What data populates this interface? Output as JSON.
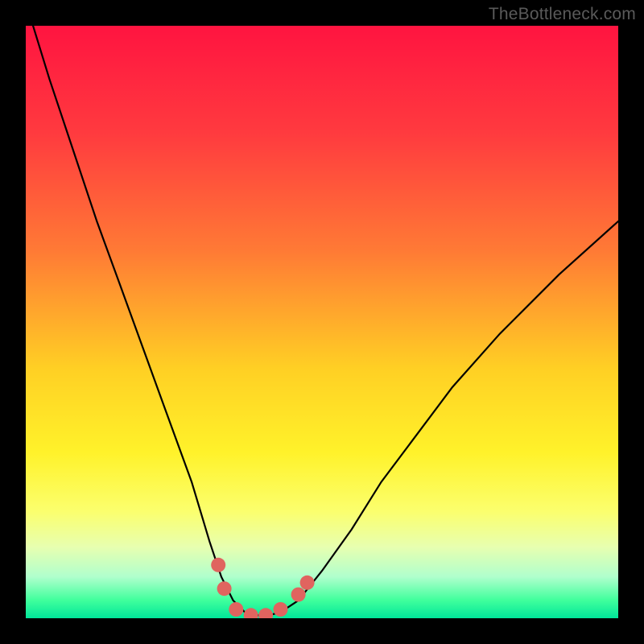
{
  "watermark": "TheBottleneck.com",
  "colors": {
    "frame": "#000000",
    "gradient_stops": [
      {
        "pct": 0,
        "color": "#ff1440"
      },
      {
        "pct": 18,
        "color": "#ff3a3f"
      },
      {
        "pct": 38,
        "color": "#ff7a35"
      },
      {
        "pct": 58,
        "color": "#ffd024"
      },
      {
        "pct": 72,
        "color": "#fff22a"
      },
      {
        "pct": 82,
        "color": "#fbff6e"
      },
      {
        "pct": 88,
        "color": "#e7ffb0"
      },
      {
        "pct": 93,
        "color": "#b0ffcd"
      },
      {
        "pct": 97,
        "color": "#3fff9c"
      },
      {
        "pct": 100,
        "color": "#00e69a"
      }
    ],
    "curve": "#000000",
    "markers": "#e0645f"
  },
  "chart_data": {
    "type": "line",
    "title": "",
    "xlabel": "",
    "ylabel": "",
    "xlim": [
      0,
      100
    ],
    "ylim": [
      0,
      100
    ],
    "series": [
      {
        "name": "bottleneck-curve",
        "x": [
          0,
          4,
          8,
          12,
          16,
          20,
          24,
          28,
          31,
          33,
          35,
          37,
          39,
          41,
          43,
          46,
          50,
          55,
          60,
          66,
          72,
          80,
          90,
          100
        ],
        "y": [
          104,
          91,
          79,
          67,
          56,
          45,
          34,
          23,
          13,
          7,
          3,
          1,
          0.5,
          0.5,
          1,
          3,
          8,
          15,
          23,
          31,
          39,
          48,
          58,
          67
        ]
      }
    ],
    "markers": {
      "name": "minimum-region",
      "points": [
        {
          "x": 32.5,
          "y": 9,
          "r": 9
        },
        {
          "x": 33.5,
          "y": 5,
          "r": 9
        },
        {
          "x": 35.5,
          "y": 1.5,
          "r": 9
        },
        {
          "x": 38,
          "y": 0.5,
          "r": 9
        },
        {
          "x": 40.5,
          "y": 0.5,
          "r": 9
        },
        {
          "x": 43,
          "y": 1.5,
          "r": 9
        },
        {
          "x": 46,
          "y": 4,
          "r": 9
        },
        {
          "x": 47.5,
          "y": 6,
          "r": 9
        }
      ]
    }
  }
}
